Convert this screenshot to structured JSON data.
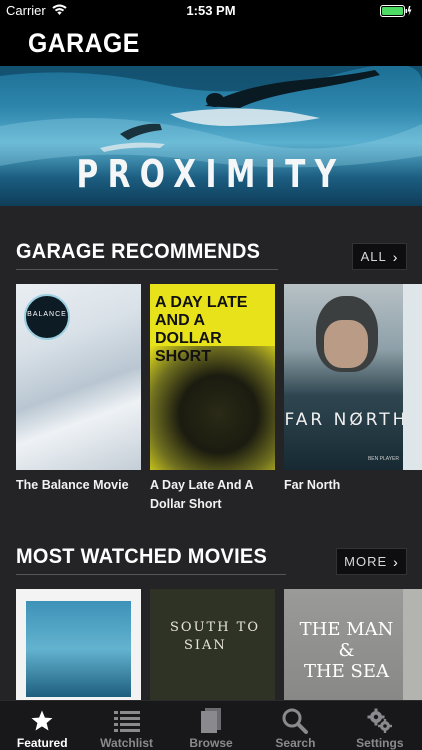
{
  "status_bar": {
    "carrier": "Carrier",
    "time": "1:53 PM"
  },
  "nav": {
    "title": "GARAGE"
  },
  "hero": {
    "title": "PROXIMITY"
  },
  "recommends": {
    "title": "GARAGE RECOMMENDS",
    "button_label": "ALL",
    "items": [
      {
        "title": "The Balance Movie",
        "poster_text": "BALANCE"
      },
      {
        "title": "A Day Late And A Dollar Short",
        "poster_text": "A DAY LATE AND A DOLLAR SHORT"
      },
      {
        "title": "Far North",
        "poster_text": "FAR NØRTH",
        "credit": "BEN PLAYER"
      }
    ]
  },
  "most_watched": {
    "title": "MOST WATCHED MOVIES",
    "button_label": "MORE",
    "items": [
      {
        "poster_text": ""
      },
      {
        "poster_text_line1": "SOUTH TO",
        "poster_text_line2": "SIAN"
      },
      {
        "poster_text_line1": "THE MAN",
        "poster_text_line2": "&",
        "poster_text_line3": "THE SEA"
      }
    ]
  },
  "tabs": [
    {
      "label": "Featured",
      "icon": "star-icon",
      "active": true
    },
    {
      "label": "Watchlist",
      "icon": "list-icon",
      "active": false
    },
    {
      "label": "Browse",
      "icon": "pages-icon",
      "active": false
    },
    {
      "label": "Search",
      "icon": "search-icon",
      "active": false
    },
    {
      "label": "Settings",
      "icon": "gear-icon",
      "active": false
    }
  ],
  "colors": {
    "background": "#242426",
    "accent_battery": "#4cd964"
  }
}
